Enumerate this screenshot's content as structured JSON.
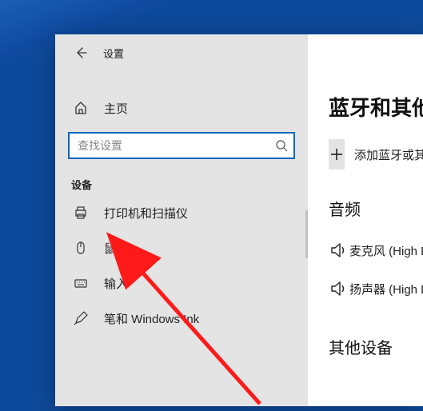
{
  "window": {
    "title": "设置"
  },
  "sidebar": {
    "home": "主页",
    "search_placeholder": "查找设置",
    "section": "设备",
    "items": [
      {
        "id": "printers",
        "label": "打印机和扫描仪"
      },
      {
        "id": "mouse",
        "label": "鼠标"
      },
      {
        "id": "typing",
        "label": "输入"
      },
      {
        "id": "pen",
        "label": "笔和 Windows Ink"
      }
    ]
  },
  "content": {
    "heading": "蓝牙和其他设备",
    "add_label": "添加蓝牙或其他设备",
    "audio_heading": "音频",
    "devices": [
      {
        "label": "麦克风 (High Definition Audio)"
      },
      {
        "label": "扬声器 (High Definition Audio)"
      }
    ],
    "other_heading": "其他设备"
  }
}
